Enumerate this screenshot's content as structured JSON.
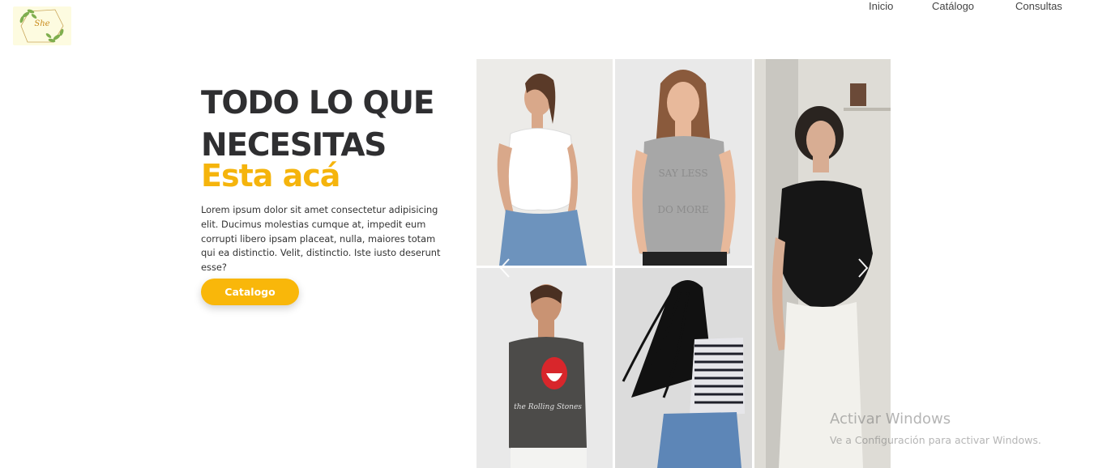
{
  "header": {
    "logo_text": "She",
    "nav": [
      {
        "label": "Inicio"
      },
      {
        "label": "Catálogo"
      },
      {
        "label": "Consultas"
      }
    ]
  },
  "hero": {
    "title_line1": "TODO LO QUE",
    "title_line2": "NECESITAS",
    "accent": "Esta acá",
    "body": "Lorem ipsum dolor sit amet consectetur adipisicing elit. Ducimus molestias cumque at, impedit eum corrupti libero ipsam placeat, nulla, maiores totam qui ea distinctio. Velit, distinctio. Iste iusto deserunt esse?",
    "button_label": "Catalogo"
  },
  "gallery": {
    "tshirt_text_1": "SAY LESS DO MORE",
    "tshirt_text_2": "the Rolling Stones",
    "prev_icon": "chevron-left-icon",
    "next_icon": "chevron-right-icon"
  },
  "watermark": {
    "title": "Activar Windows",
    "subtitle": "Ve a Configuración para activar Windows."
  },
  "colors": {
    "accent": "#f9b70a",
    "title": "#2f2f31",
    "logo_bg": "#fdfbe0"
  }
}
